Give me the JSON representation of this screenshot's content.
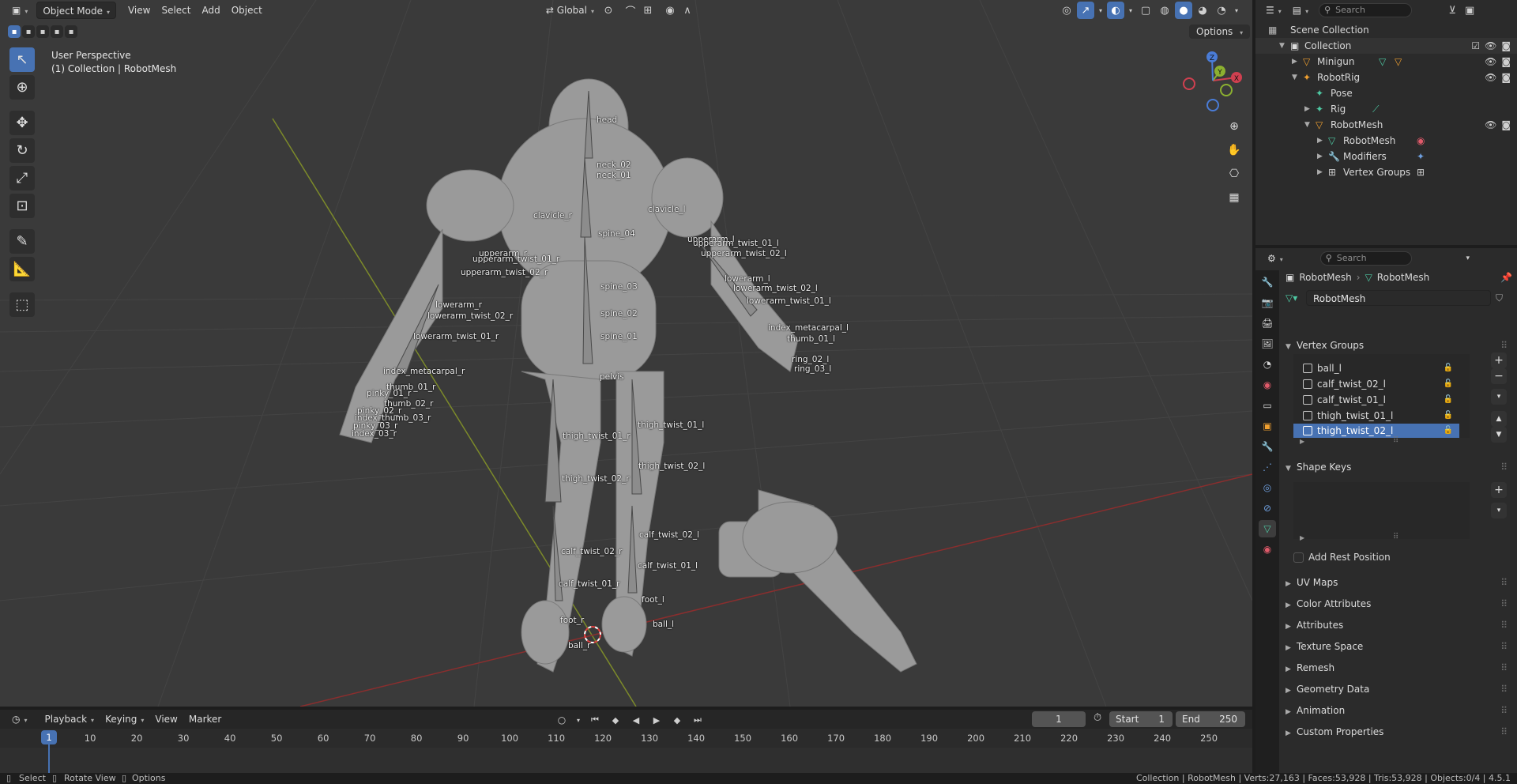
{
  "viewport": {
    "mode": "Object Mode",
    "menu": [
      "View",
      "Select",
      "Add",
      "Object"
    ],
    "orientation": "Global",
    "options_label": "Options",
    "perspective": "User Perspective",
    "collection_info": "(1) Collection | RobotMesh",
    "gizmo_axes": [
      "X",
      "Y",
      "Z"
    ],
    "bone_labels": [
      "head",
      "neck_02",
      "neck_01",
      "clavicle_r",
      "clavicle_l",
      "spine_04",
      "upperarm_r",
      "upperarm_twist_01_r",
      "upperarm_twist_02_r",
      "upperarm_l",
      "upperarm_twist_01_l",
      "upperarm_twist_02_l",
      "spine_03",
      "spine_02",
      "spine_01",
      "lowerarm_r",
      "lowerarm_twist_02_r",
      "lowerarm_twist_01_r",
      "lowerarm_l",
      "lowerarm_twist_02_l",
      "lowerarm_twist_01_l",
      "index_metacarpal_r",
      "thumb_01_r",
      "pinky_01_r",
      "thumb_02_r",
      "pinky_02_r",
      "index_thumb_03_r",
      "pinky_03_r",
      "index_03_r",
      "pelvis",
      "thigh_twist_01_r",
      "thigh_twist_01_l",
      "thigh_twist_02_r",
      "thigh_twist_02_l",
      "calf_twist_02_l",
      "calf_twist_02_r",
      "calf_twist_01_l",
      "calf_twist_01_r",
      "foot_r",
      "foot_l",
      "ball_l",
      "ball_r",
      "index_metacarpal_l",
      "thumb_01_l",
      "ring_02_l",
      "ring_03_l"
    ]
  },
  "timeline": {
    "menu": [
      "Playback",
      "Keying",
      "View",
      "Marker"
    ],
    "current_frame": "1",
    "start_label": "Start",
    "start_value": "1",
    "end_label": "End",
    "end_value": "250",
    "ticks": [
      "10",
      "20",
      "30",
      "40",
      "50",
      "60",
      "70",
      "80",
      "90",
      "100",
      "110",
      "120",
      "130",
      "140",
      "150",
      "160",
      "170",
      "180",
      "190",
      "200",
      "210",
      "220",
      "230",
      "240",
      "250"
    ],
    "playhead_label": "1"
  },
  "status": {
    "left": [
      "Select",
      "Rotate View",
      "Options"
    ],
    "right": "Collection | RobotMesh | Verts:27,163 | Faces:53,928 | Tris:53,928 | Objects:0/4 | 4.5.1"
  },
  "outliner": {
    "search_placeholder": "Search",
    "rows": [
      {
        "label": "Scene Collection"
      },
      {
        "label": "Collection"
      },
      {
        "label": "Minigun"
      },
      {
        "label": "RobotRig"
      },
      {
        "label": "Pose"
      },
      {
        "label": "Rig"
      },
      {
        "label": "RobotMesh"
      },
      {
        "label": "RobotMesh"
      },
      {
        "label": "Modifiers"
      },
      {
        "label": "Vertex Groups"
      }
    ]
  },
  "properties": {
    "search_placeholder": "Search",
    "breadcrumb": [
      "RobotMesh",
      "RobotMesh"
    ],
    "data_name": "RobotMesh",
    "panels": {
      "vertex_groups": "Vertex Groups",
      "shape_keys": "Shape Keys",
      "add_rest_position": "Add Rest Position",
      "collapsed": [
        "UV Maps",
        "Color Attributes",
        "Attributes",
        "Texture Space",
        "Remesh",
        "Geometry Data",
        "Animation",
        "Custom Properties"
      ]
    },
    "vertex_groups": [
      "ball_l",
      "calf_twist_02_l",
      "calf_twist_01_l",
      "thigh_twist_01_l",
      "thigh_twist_02_l"
    ],
    "selected_vertex_group": "thigh_twist_02_l"
  }
}
